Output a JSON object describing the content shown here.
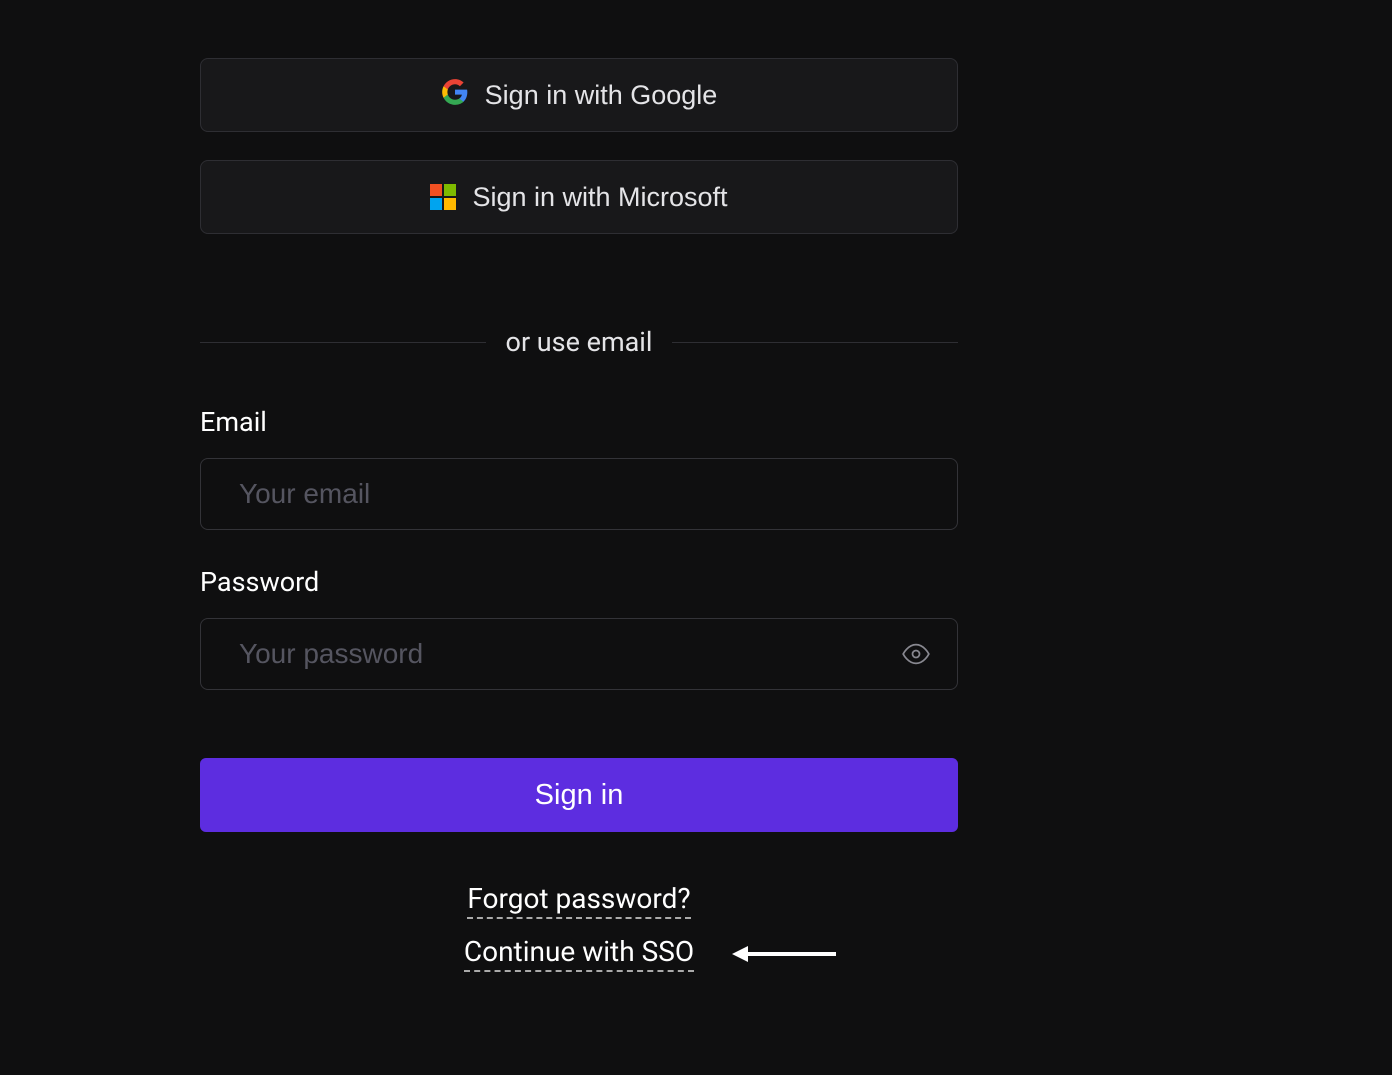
{
  "oauth": {
    "google_label": "Sign in with Google",
    "microsoft_label": "Sign in with Microsoft"
  },
  "divider": {
    "text": "or use email"
  },
  "email": {
    "label": "Email",
    "placeholder": "Your email",
    "value": ""
  },
  "password": {
    "label": "Password",
    "placeholder": "Your password",
    "value": ""
  },
  "signin": {
    "label": "Sign in"
  },
  "links": {
    "forgot_password": "Forgot password?",
    "continue_sso": "Continue with SSO"
  }
}
